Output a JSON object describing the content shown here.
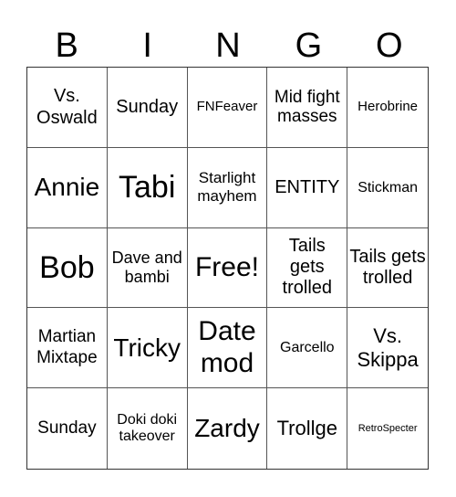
{
  "header": {
    "letters": [
      "B",
      "I",
      "N",
      "G",
      "O"
    ]
  },
  "cells": [
    [
      "Vs. Oswald",
      "Sunday",
      "FNFeaver",
      "Mid fight masses",
      "Herobrine"
    ],
    [
      "Annie",
      "Tabi",
      "Starlight mayhem",
      "ENTITY",
      "Stickman"
    ],
    [
      "Bob",
      "Dave and bambi",
      "Free!",
      "Tails gets trolled",
      "Tails gets trolled"
    ],
    [
      "Martian Mixtape",
      "Tricky",
      "Date mod",
      "Garcello",
      "Vs. Skippa"
    ],
    [
      "Sunday",
      "Doki doki takeover",
      "Zardy",
      "Trollge",
      "RetroSpecter"
    ]
  ]
}
